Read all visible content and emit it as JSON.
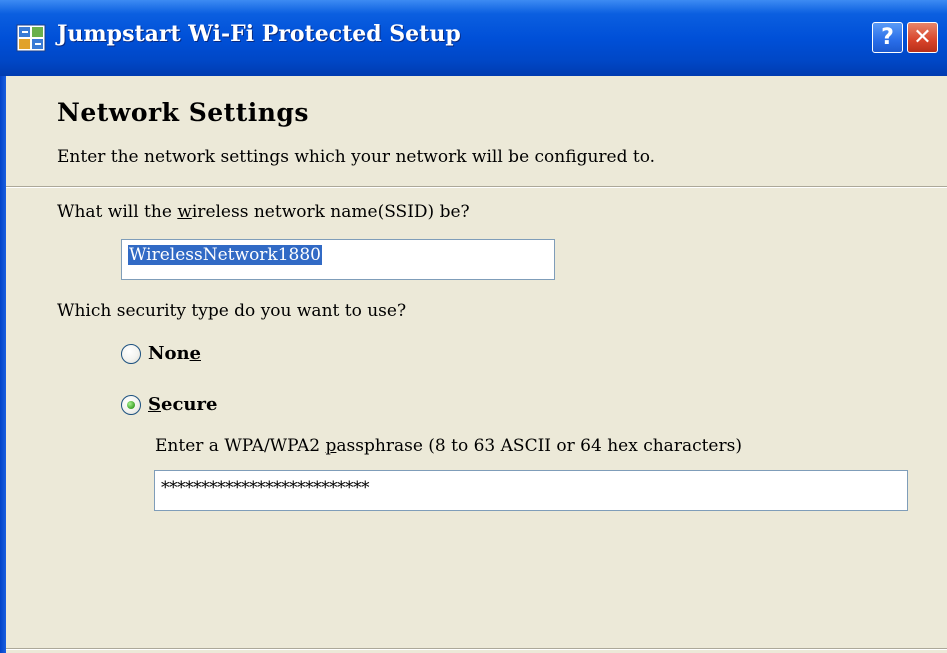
{
  "window": {
    "title": "Jumpstart Wi-Fi Protected Setup",
    "help_label": "?",
    "close_label": "✕"
  },
  "header": {
    "title": "Network Settings",
    "subtitle": "Enter the network settings which your network will be configured to."
  },
  "ssid": {
    "question_pre": "What will the ",
    "question_accel": "w",
    "question_post": "ireless network name(SSID) be?",
    "value": "WirelessNetwork1880"
  },
  "security": {
    "question": "Which security type do you want to use?",
    "options": [
      {
        "label_pre": "Non",
        "label_accel": "e",
        "label_post": "",
        "selected": false
      },
      {
        "label_pre": "",
        "label_accel": "S",
        "label_post": "ecure",
        "selected": true
      }
    ],
    "passphrase_prompt_pre": "Enter a WPA/WPA2 ",
    "passphrase_prompt_accel": "p",
    "passphrase_prompt_post": "assphrase (8 to 63 ASCII or 64 hex characters)",
    "passphrase_masked": "**************************"
  },
  "colors": {
    "titlebar": "#0050d8",
    "window_bg": "#ece9d8",
    "selection": "#316ac5",
    "radio_dot": "#3fa22a"
  },
  "icons": {
    "app": "network-setup-icon",
    "help": "help-icon",
    "close": "close-icon"
  }
}
